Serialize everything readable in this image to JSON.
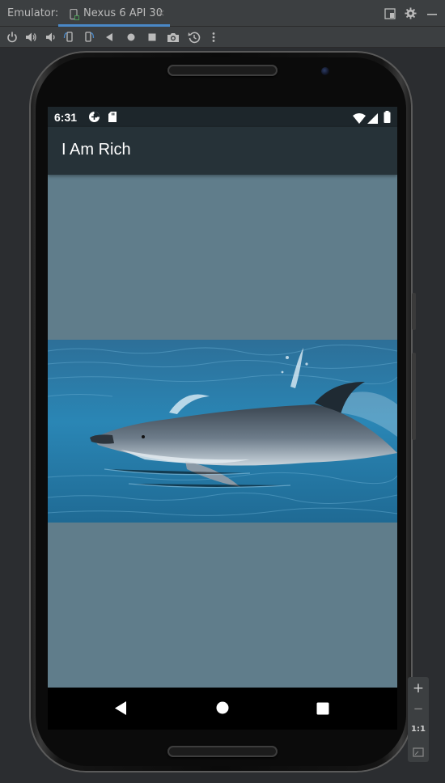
{
  "ide": {
    "tool_window_label": "Emulator:",
    "tab": {
      "label": "Nexus 6 API 30",
      "close_glyph": "×"
    },
    "window_icons": [
      "dock-layout-icon",
      "gear-icon",
      "minimize-icon"
    ],
    "toolbar_icons": [
      "power-icon",
      "volume-up-icon",
      "volume-down-icon",
      "rotate-left-icon",
      "rotate-right-icon",
      "back-icon",
      "home-icon",
      "overview-icon",
      "screenshot-camera-icon",
      "snapshot-restore-icon",
      "more-options-icon"
    ]
  },
  "device": {
    "status_bar": {
      "time": "6:31",
      "left_icons": [
        "data-saver-icon",
        "sd-card-icon"
      ],
      "right_icons": [
        "wifi-icon",
        "signal-icon",
        "battery-icon"
      ]
    },
    "app": {
      "title": "I Am Rich",
      "background_color": "#607d8b",
      "app_bar_color": "#263238",
      "image": "dolphin-photo"
    },
    "nav_bar": [
      "nav-back-icon",
      "nav-home-icon",
      "nav-recents-icon"
    ]
  },
  "zoom_controls": {
    "plus": "+",
    "minus": "−",
    "actual_size": "1:1",
    "fit_icon": "zoom-fit-icon"
  }
}
